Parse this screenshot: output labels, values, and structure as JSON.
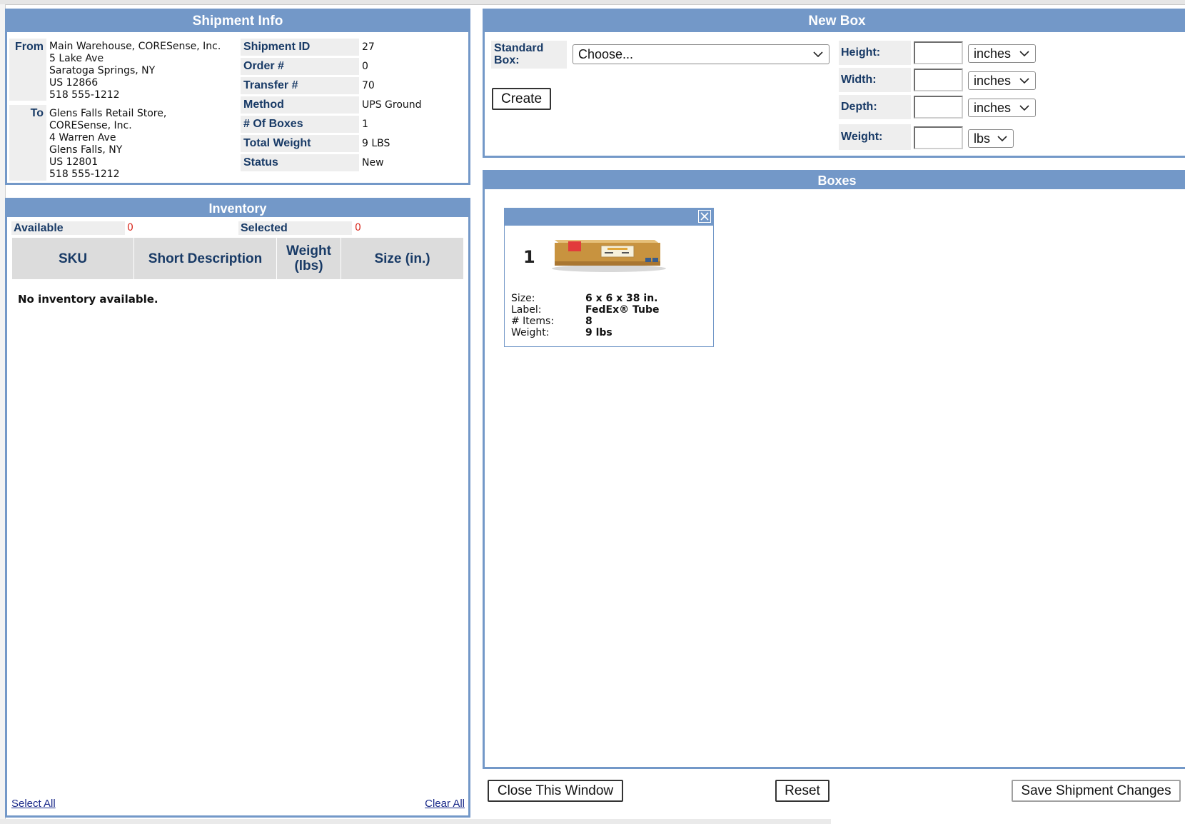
{
  "shipment_info": {
    "title": "Shipment Info",
    "from_label": "From",
    "from_lines": [
      "Main Warehouse, CORESense, Inc.",
      "5 Lake Ave",
      "Saratoga Springs, NY",
      "US 12866",
      "518 555-1212"
    ],
    "to_label": "To",
    "to_lines": [
      "Glens Falls Retail Store,",
      "CORESense, Inc.",
      "4 Warren Ave",
      "Glens Falls, NY",
      "US 12801",
      "518 555-1212"
    ],
    "fields": [
      {
        "label": "Shipment ID",
        "value": "27"
      },
      {
        "label": "Order #",
        "value": "0"
      },
      {
        "label": "Transfer #",
        "value": "70"
      },
      {
        "label": "Method",
        "value": "UPS Ground"
      },
      {
        "label": "# Of Boxes",
        "value": "1"
      },
      {
        "label": "Total Weight",
        "value": "9 LBS"
      },
      {
        "label": "Status",
        "value": "New"
      }
    ]
  },
  "inventory": {
    "title": "Inventory",
    "available_label": "Available",
    "available_value": "0",
    "selected_label": "Selected",
    "selected_value": "0",
    "columns": [
      "SKU",
      "Short Description",
      "Weight (lbs)",
      "Size (in.)"
    ],
    "empty_message": "No inventory available.",
    "select_all": "Select All",
    "clear_all": "Clear All"
  },
  "new_box": {
    "title": "New Box",
    "standard_box_label": "Standard Box:",
    "standard_box_value": "Choose...",
    "create_button": "Create",
    "height_label": "Height:",
    "height_unit": "inches",
    "width_label": "Width:",
    "width_unit": "inches",
    "depth_label": "Depth:",
    "depth_unit": "inches",
    "weight_label": "Weight:",
    "weight_unit": "lbs"
  },
  "boxes": {
    "title": "Boxes",
    "items": [
      {
        "number": "1",
        "size_label": "Size:",
        "size_value": "6 x 6 x 38 in.",
        "label_label": "Label:",
        "label_value": "FedEx® Tube",
        "items_label": "# Items:",
        "items_value": "8",
        "weight_label": "Weight:",
        "weight_value": "9 lbs"
      }
    ]
  },
  "footer": {
    "close_button": "Close This Window",
    "reset_button": "Reset",
    "save_button": "Save Shipment Changes"
  },
  "colors": {
    "header_blue": "#7398c8",
    "label_navy": "#183a66",
    "count_red": "#d8271c"
  }
}
